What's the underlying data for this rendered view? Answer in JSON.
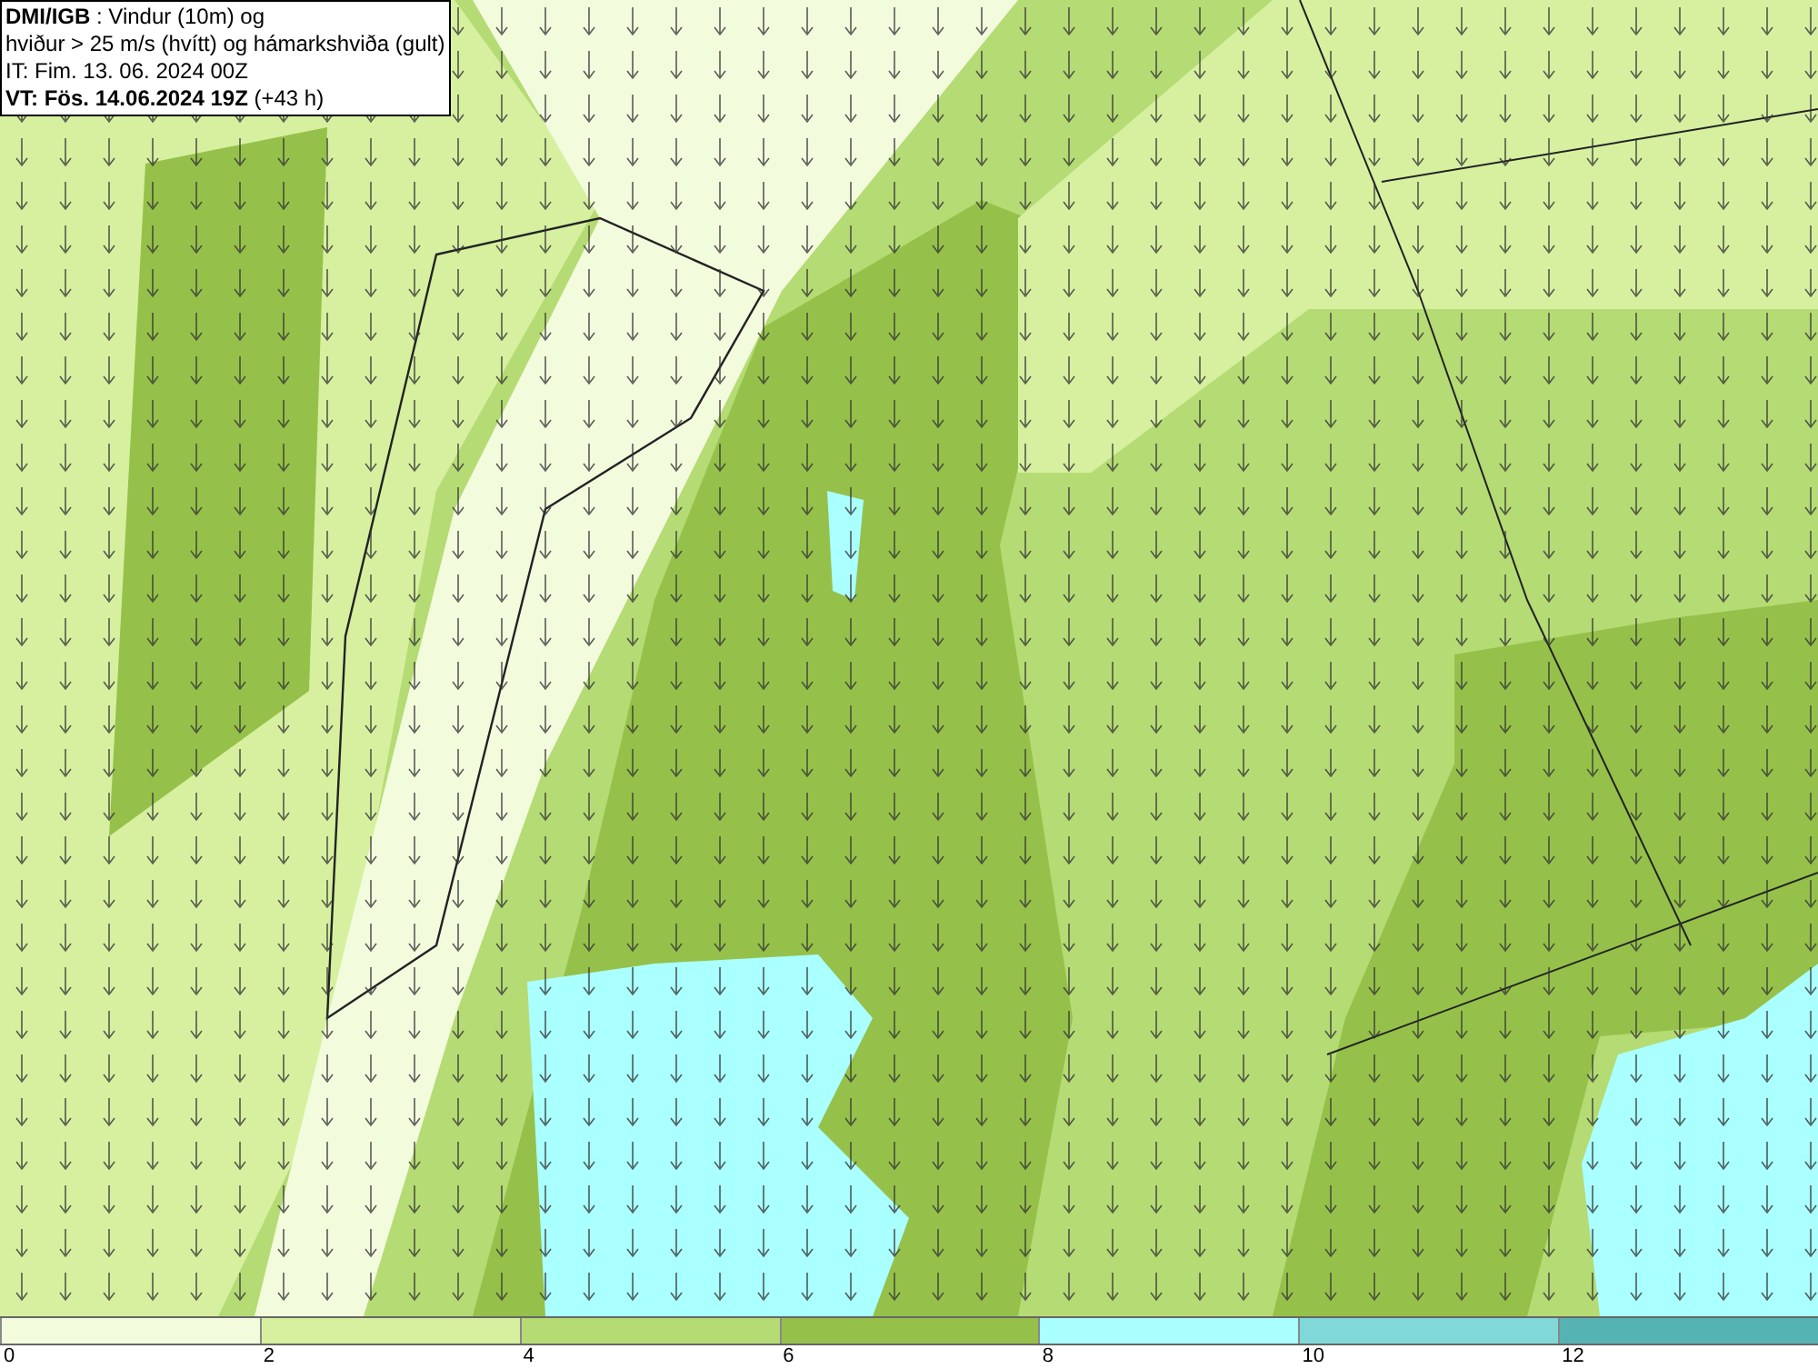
{
  "header": {
    "lines": [
      "**DMI/IGB** : Vindur (10m) og",
      "hviður > 25 m/s (hvítt) og hámarkshviða (gult)",
      "IT: Fim. 13. 06. 2024 00Z",
      "**VT: Fös. 14.06.2024 19Z** (+43 h)"
    ]
  },
  "legend": [
    {
      "label": "0",
      "color": "#f3fbdd"
    },
    {
      "label": "2",
      "color": "#d6f0a0"
    },
    {
      "label": "4",
      "color": "#b5db74"
    },
    {
      "label": "6",
      "color": "#95c14a"
    },
    {
      "label": "8",
      "color": "#aaffff"
    },
    {
      "label": "10",
      "color": "#80d8d8"
    },
    {
      "label": "12",
      "color": "#55b3b3"
    }
  ]
}
